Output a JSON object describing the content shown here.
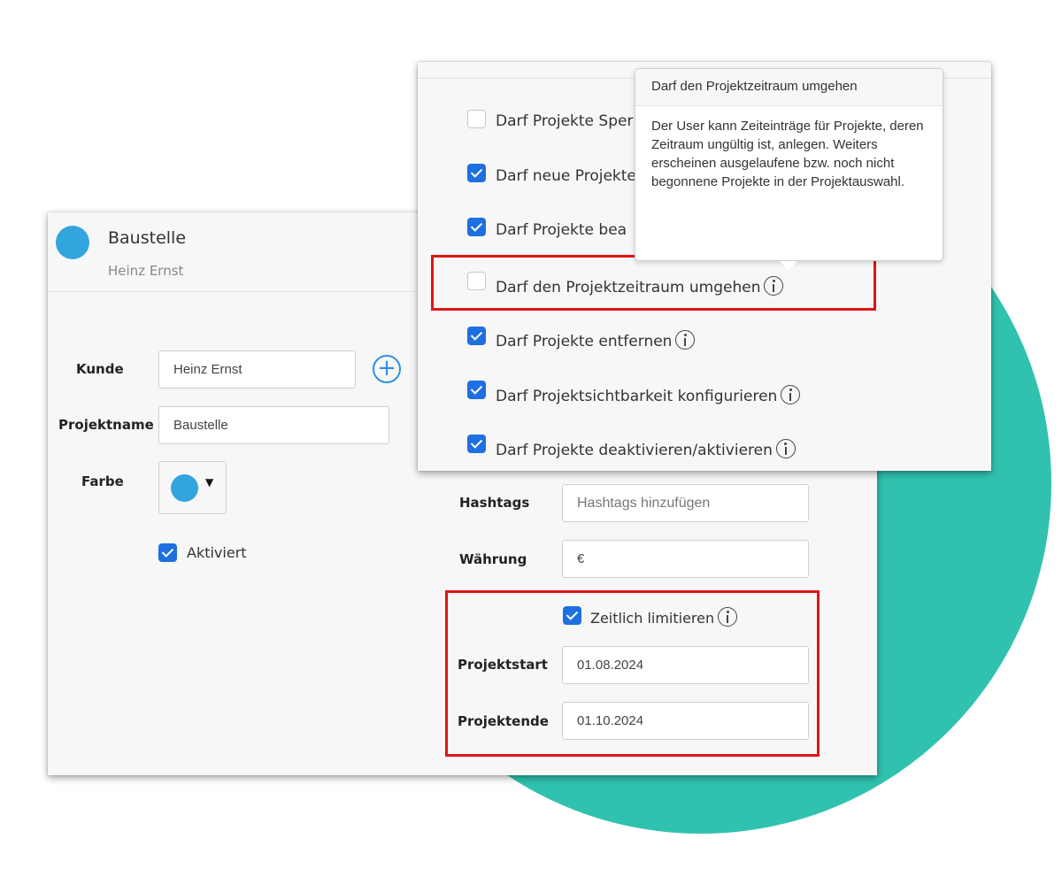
{
  "project": {
    "title": "Baustelle",
    "subtitle": "Heinz Ernst",
    "color": "#33a5de"
  },
  "form": {
    "customer_label": "Kunde",
    "customer_value": "Heinz Ernst",
    "name_label": "Projektname",
    "name_value": "Baustelle",
    "color_label": "Farbe",
    "active_label": "Aktiviert",
    "hashtags_label": "Hashtags",
    "hashtags_placeholder": "Hashtags hinzufügen",
    "currency_label": "Währung",
    "currency_value": "€",
    "time_limit_label": "Zeitlich limitieren",
    "start_label": "Projektstart",
    "start_value": "01.08.2024",
    "end_label": "Projektende",
    "end_value": "01.10.2024"
  },
  "permissions": [
    {
      "label": "Darf Projekte Sper",
      "checked": false
    },
    {
      "label": "Darf neue Projekte",
      "checked": true
    },
    {
      "label": "Darf Projekte bea",
      "checked": true
    },
    {
      "label": "Darf den Projektzeitraum umgehen",
      "checked": false
    },
    {
      "label": "Darf Projekte entfernen",
      "checked": true
    },
    {
      "label": "Darf Projektsichtbarkeit konfigurieren",
      "checked": true
    },
    {
      "label": "Darf Projekte deaktivieren/aktivieren",
      "checked": true
    }
  ],
  "tooltip": {
    "title": "Darf den Projektzeitraum umgehen",
    "body": "Der User kann Zeiteinträge für Projekte, deren Zeitraum ungültig ist, anlegen. Weiters erscheinen ausgelaufene bzw. noch nicht begonnene Projekte in der Projektauswahl."
  },
  "colors": {
    "accent": "#1e6fe0",
    "highlight": "#e01414",
    "teal": "#30c2ae",
    "project_dot": "#33a5de"
  },
  "icons": [
    "info-icon",
    "plus-icon",
    "caret-down-icon",
    "checkbox-icon"
  ]
}
